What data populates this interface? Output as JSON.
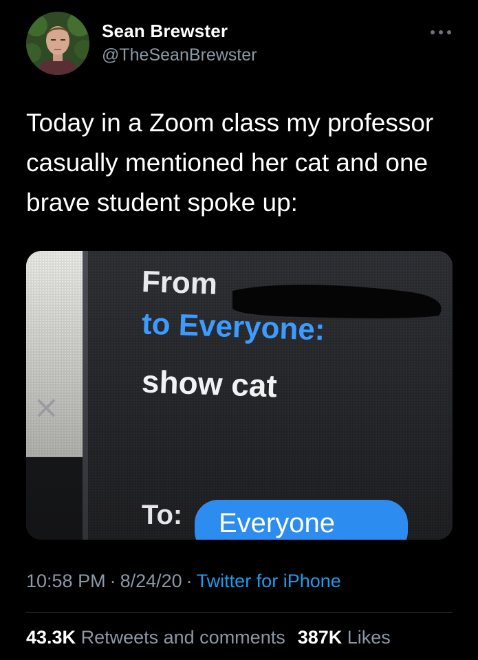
{
  "author": {
    "display_name": "Sean Brewster",
    "handle": "@TheSeanBrewster"
  },
  "tweet": {
    "text": "Today in a Zoom class my professor casually mentioned her cat and one brave student spoke up:"
  },
  "media": {
    "from_label": "From",
    "to_everyone": "to Everyone:",
    "message": "show cat",
    "to_label": "To:",
    "recipient": "Everyone",
    "close_glyph": "×"
  },
  "meta": {
    "time": "10:58 PM",
    "date": "8/24/20",
    "separator": "·",
    "source": "Twitter for iPhone"
  },
  "stats": {
    "retweets_count": "43.3K",
    "retweets_label": "Retweets and comments",
    "likes_count": "387K",
    "likes_label": "Likes"
  },
  "colors": {
    "background": "#000000",
    "link": "#1d9bf0",
    "secondary_text": "#8b98a5"
  }
}
